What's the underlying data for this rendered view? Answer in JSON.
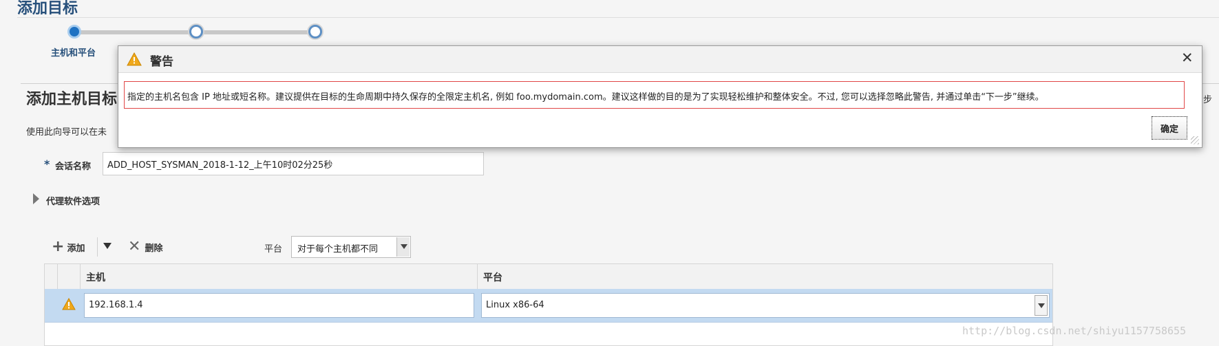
{
  "page": {
    "title": "添加目标",
    "section_title": "添加主机目标",
    "section_desc": "使用此向导可以在未",
    "right_edge_text": "步"
  },
  "train": {
    "steps": [
      {
        "label": "主机和平台",
        "state": "current"
      },
      {
        "label": "",
        "state": "pending"
      },
      {
        "label": "",
        "state": "pending"
      }
    ]
  },
  "form": {
    "session_label": "会话名称",
    "required_mark": "*",
    "session_value": "ADD_HOST_SYSMAN_2018-1-12_上午10时02分25秒",
    "agent_options_label": "代理软件选项"
  },
  "toolbar": {
    "add_label": "添加",
    "delete_label": "删除",
    "platform_label": "平台",
    "platform_value": "对于每个主机都不同"
  },
  "table": {
    "columns": [
      "主机",
      "平台"
    ],
    "rows": [
      {
        "status_icon": "warning-icon",
        "host": "192.168.1.4",
        "platform": "Linux x86-64"
      }
    ]
  },
  "dialog": {
    "title": "警告",
    "icon": "warning-icon",
    "message": "指定的主机名包含 IP 地址或短名称。建议提供在目标的生命周期中持久保存的全限定主机名, 例如 foo.mydomain.com。建议这样做的目的是为了实现轻松维护和整体安全。不过, 您可以选择忽略此警告, 并通过单击“下一步”继续。",
    "ok_label": "确定",
    "close_glyph": "✕"
  },
  "watermark": "http://blog.csdn.net/shiyu1157758655",
  "colors": {
    "accent": "#1f72c2",
    "title_blue": "#27507b",
    "row_selected": "#c3daf1",
    "warning": "#f0a91c",
    "message_border": "#e04545"
  }
}
